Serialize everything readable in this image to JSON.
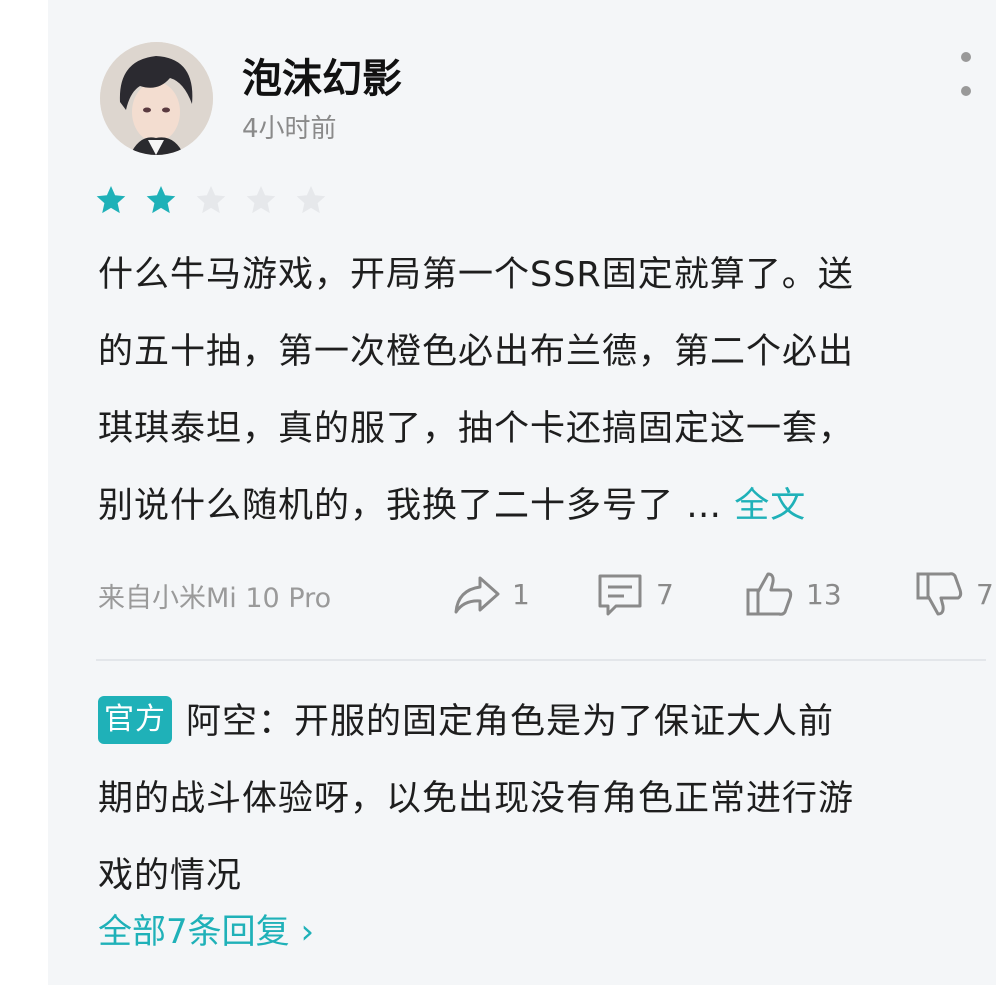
{
  "review": {
    "username": "泡沫幻影",
    "time": "4小时前",
    "rating": 2,
    "max_rating": 5,
    "text_lines": [
      "什么牛马游戏，开局第一个SSR固定就算了。送",
      "的五十抽，第一次橙色必出布兰德，第二个必出",
      "琪琪泰坦，真的服了，抽个卡还搞固定这一套，",
      "别说什么随机的，我换了二十多号了 … "
    ],
    "more_link": "全文",
    "device": "来自小米Mi 10 Pro",
    "shares": "1",
    "comments": "7",
    "likes": "13",
    "dislikes": "7"
  },
  "official_reply": {
    "badge": "官方",
    "lines": [
      "阿空：开服的固定角色是为了保证大人前",
      "期的战斗体验呀，以免出现没有角色正常进行游",
      "戏的情况"
    ],
    "all_replies_label": "全部7条回复 ›"
  },
  "colors": {
    "accent": "#1fb1b8",
    "star_filled": "#1fb1b8",
    "star_empty": "#e6e8eb",
    "card_background": "#f4f6f8"
  }
}
